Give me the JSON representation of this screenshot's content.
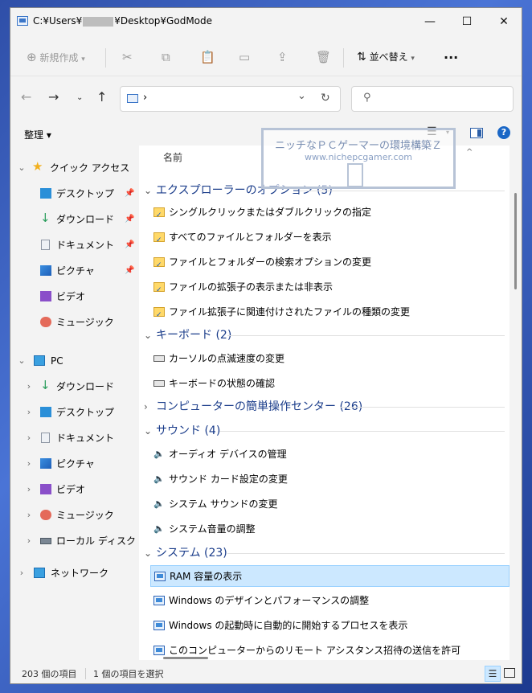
{
  "window": {
    "title_prefix": "C:¥Users¥",
    "title_suffix": "¥Desktop¥GodMode",
    "controls": {
      "minimize": "—",
      "maximize": "☐",
      "close": "✕"
    }
  },
  "toolbar": {
    "new_label": "新規作成",
    "sort_label": "並べ替え",
    "more": "..."
  },
  "nav": {
    "address_sep": "›",
    "dropdown": "⌄",
    "refresh": "↻",
    "search_placeholder": ""
  },
  "cmdbar": {
    "organize": "整理 ▾"
  },
  "sidebar": {
    "quick_access": "クイック アクセス",
    "quick_items": [
      "デスクトップ",
      "ダウンロード",
      "ドキュメント",
      "ピクチャ",
      "ビデオ",
      "ミュージック"
    ],
    "pc": "PC",
    "pc_items": [
      "ダウンロード",
      "デスクトップ",
      "ドキュメント",
      "ピクチャ",
      "ビデオ",
      "ミュージック",
      "ローカル ディスク (C:)"
    ],
    "network": "ネットワーク"
  },
  "main": {
    "column_name": "名前",
    "groups": [
      {
        "title": "エクスプローラーのオプション (5)",
        "expanded": true,
        "icon": "control-panel-icon",
        "items": [
          "シングルクリックまたはダブルクリックの指定",
          "すべてのファイルとフォルダーを表示",
          "ファイルとフォルダーの検索オプションの変更",
          "ファイルの拡張子の表示または非表示",
          "ファイル拡張子に関連付けされたファイルの種類の変更"
        ]
      },
      {
        "title": "キーボード (2)",
        "expanded": true,
        "icon": "keyboard-icon",
        "items": [
          "カーソルの点滅速度の変更",
          "キーボードの状態の確認"
        ]
      },
      {
        "title": "コンピューターの簡単操作センター (26)",
        "expanded": false,
        "icon": "",
        "items": []
      },
      {
        "title": "サウンド (4)",
        "expanded": true,
        "icon": "speaker-icon",
        "items": [
          "オーディオ デバイスの管理",
          "サウンド カード設定の変更",
          "システム サウンドの変更",
          "システム音量の調整"
        ]
      },
      {
        "title": "システム (23)",
        "expanded": true,
        "icon": "system-icon",
        "items": [
          "RAM 容量の表示",
          "Windows のデザインとパフォーマンスの調整",
          "Windows の起動時に自動的に開始するプロセスを表示",
          "このコンピューターからのリモート アシスタンス招待の送信を許可"
        ]
      }
    ],
    "selected_item": "RAM 容量の表示"
  },
  "watermark": {
    "line1": "ニッチなＰＣゲーマーの環境構築Ｚ",
    "line2": "www.nichepcgamer.com"
  },
  "status": {
    "count": "203 個の項目",
    "selected": "1 個の項目を選択"
  }
}
